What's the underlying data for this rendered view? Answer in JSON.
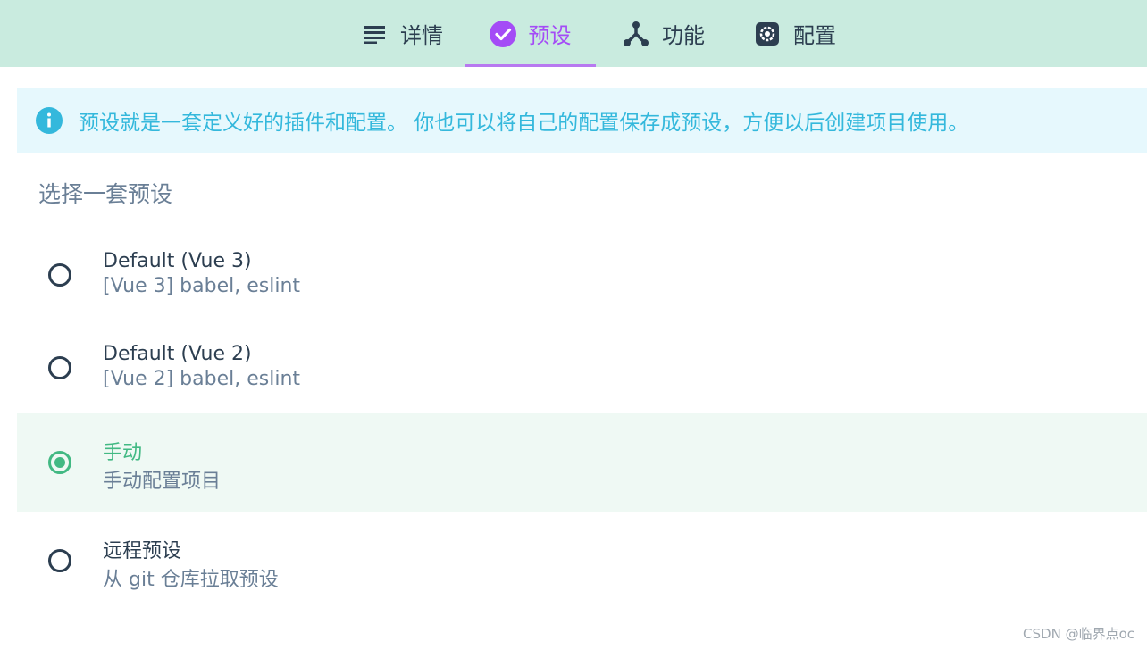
{
  "tabs": [
    {
      "label": "详情",
      "icon": "list-icon"
    },
    {
      "label": "预设",
      "icon": "check-circle-icon"
    },
    {
      "label": "功能",
      "icon": "fork-icon"
    },
    {
      "label": "配置",
      "icon": "settings-icon"
    }
  ],
  "active_tab": "预设",
  "info": {
    "text": "预设就是一套定义好的插件和配置。 你也可以将自己的配置保存成预设，方便以后创建项目使用。",
    "icon": "info-icon"
  },
  "section_title": "选择一套预设",
  "presets": [
    {
      "title": "Default (Vue 3)",
      "desc": "[Vue 3] babel, eslint",
      "selected": false
    },
    {
      "title": "Default (Vue 2)",
      "desc": "[Vue 2] babel, eslint",
      "selected": false
    },
    {
      "title": "手动",
      "desc": "手动配置项目",
      "selected": true
    },
    {
      "title": "远程预设",
      "desc": "从 git 仓库拉取预设",
      "selected": false
    }
  ],
  "watermark": "CSDN @临界点oc",
  "colors": {
    "topbar": "#c9ebdf",
    "active_tab": "#a44cf6",
    "selected": "#42b983",
    "info_text": "#34b8dc",
    "info_bg": "#e6f8fd"
  }
}
